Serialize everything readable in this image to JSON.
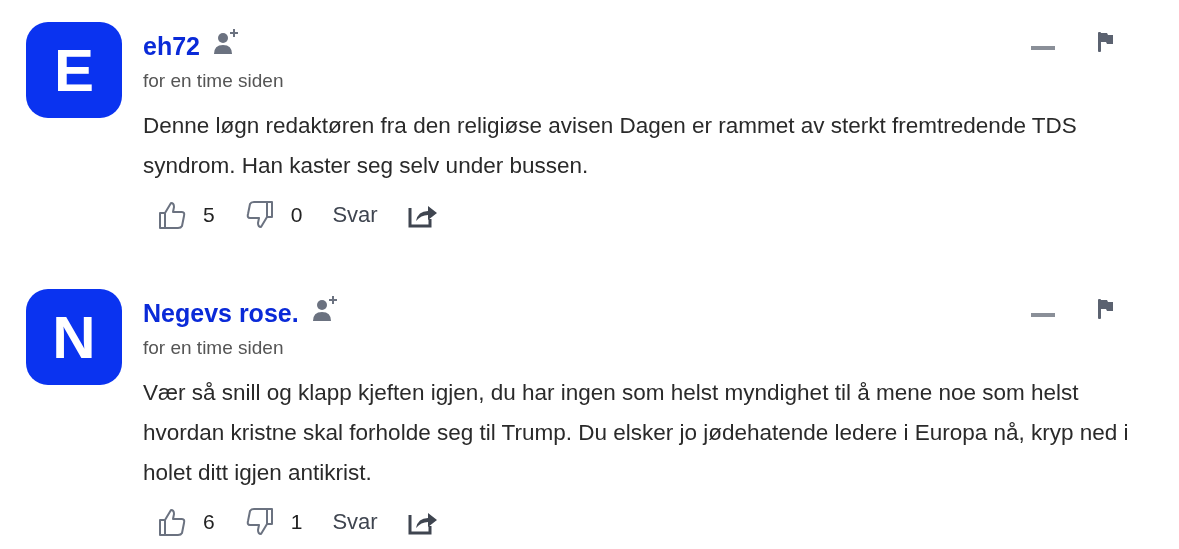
{
  "comments": [
    {
      "initial": "E",
      "author": "eh72",
      "time": "for en time siden",
      "text": "Denne løgn redaktøren fra den religiøse avisen Dagen er rammet av sterkt fremtredende TDS syndrom. Han kaster seg selv under bussen.",
      "likes": "5",
      "dislikes": "0",
      "reply": "Svar"
    },
    {
      "initial": "N",
      "author": "Negevs rose.",
      "time": "for en time siden",
      "text": "Vær så snill og klapp kjeften igjen, du har ingen som helst myndighet til å mene noe som helst hvordan kristne skal forholde seg til Trump. Du elsker jo jødehatende ledere i Europa nå, kryp ned i holet ditt igjen antikrist.",
      "likes": "6",
      "dislikes": "1",
      "reply": "Svar"
    }
  ]
}
